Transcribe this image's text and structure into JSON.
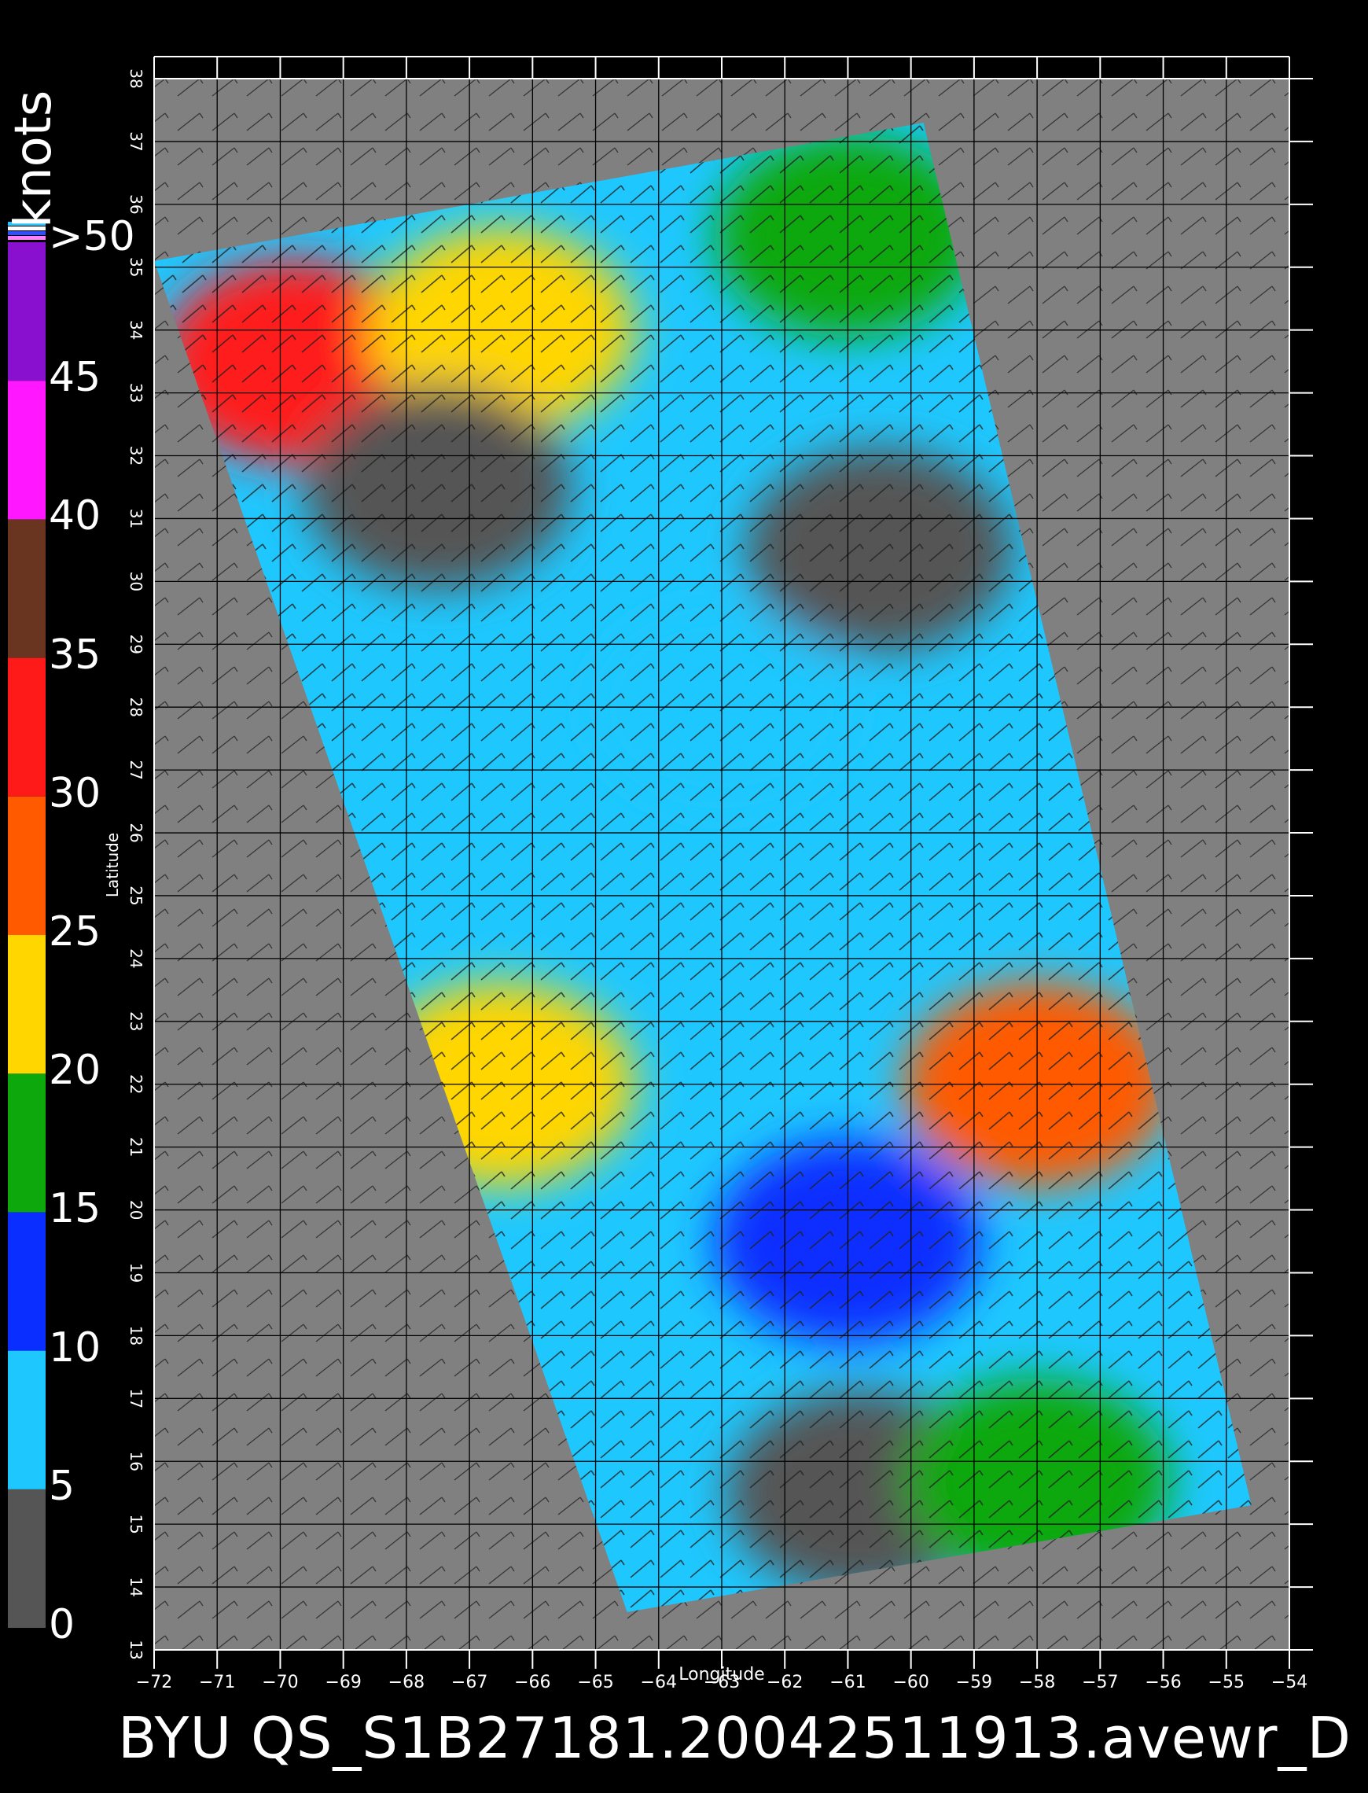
{
  "chart_data": {
    "type": "heatmap",
    "title": "BYU  QS_S1B27181.20042511913.avewr_D",
    "xlabel": "Longitude",
    "ylabel": "Latitude",
    "xlim": [
      -72,
      -54
    ],
    "ylim": [
      13,
      38
    ],
    "x_ticks": [
      -72,
      -71,
      -70,
      -69,
      -68,
      -67,
      -66,
      -65,
      -64,
      -63,
      -62,
      -61,
      -60,
      -59,
      -58,
      -57,
      -56,
      -55,
      -54
    ],
    "y_ticks": [
      13,
      14,
      15,
      16,
      17,
      18,
      19,
      20,
      21,
      22,
      23,
      24,
      25,
      26,
      27,
      28,
      29,
      30,
      31,
      32,
      33,
      34,
      35,
      36,
      37,
      38
    ],
    "grid": true,
    "swath_corners": [
      [
        -72.0,
        35.1
      ],
      [
        -59.8,
        37.3
      ],
      [
        -54.6,
        15.3
      ],
      [
        -64.5,
        13.6
      ]
    ],
    "colorbar": {
      "units": "knots",
      "labels": [
        "0",
        "5",
        "10",
        "15",
        "20",
        "25",
        "30",
        "35",
        "40",
        "45",
        ">50"
      ],
      "bands": [
        {
          "from": 0,
          "to": 5,
          "color": "#555555"
        },
        {
          "from": 5,
          "to": 10,
          "color": "#1ec8ff"
        },
        {
          "from": 10,
          "to": 15,
          "color": "#0a2eff"
        },
        {
          "from": 15,
          "to": 20,
          "color": "#0ca80c"
        },
        {
          "from": 20,
          "to": 25,
          "color": "#ffd600"
        },
        {
          "from": 25,
          "to": 30,
          "color": "#ff5a00"
        },
        {
          "from": 30,
          "to": 35,
          "color": "#ff1a1a"
        },
        {
          "from": 35,
          "to": 40,
          "color": "#6a3520"
        },
        {
          "from": 40,
          "to": 45,
          "color": "#ff18ff"
        },
        {
          "from": 45,
          "to": 50,
          "color": "#8a10d0"
        }
      ]
    },
    "wind_regions": [
      {
        "lon": -63,
        "lat": 28,
        "speed": 8
      },
      {
        "lon": -61,
        "lat": 19.5,
        "speed": 12
      },
      {
        "lon": -61,
        "lat": 35.5,
        "speed": 17
      },
      {
        "lon": -66.5,
        "lat": 22,
        "speed": 24
      },
      {
        "lon": -58,
        "lat": 22,
        "speed": 28
      },
      {
        "lon": -60.8,
        "lat": 15.5,
        "speed": 3
      },
      {
        "lon": -69.8,
        "lat": 33.5,
        "speed": 30
      },
      {
        "lon": -66.5,
        "lat": 34,
        "speed": 22
      },
      {
        "lon": -67.5,
        "lat": 31.5,
        "speed": 3
      },
      {
        "lon": -60.5,
        "lat": 30.5,
        "speed": 3
      },
      {
        "lon": -58,
        "lat": 15.7,
        "speed": 18
      }
    ]
  }
}
